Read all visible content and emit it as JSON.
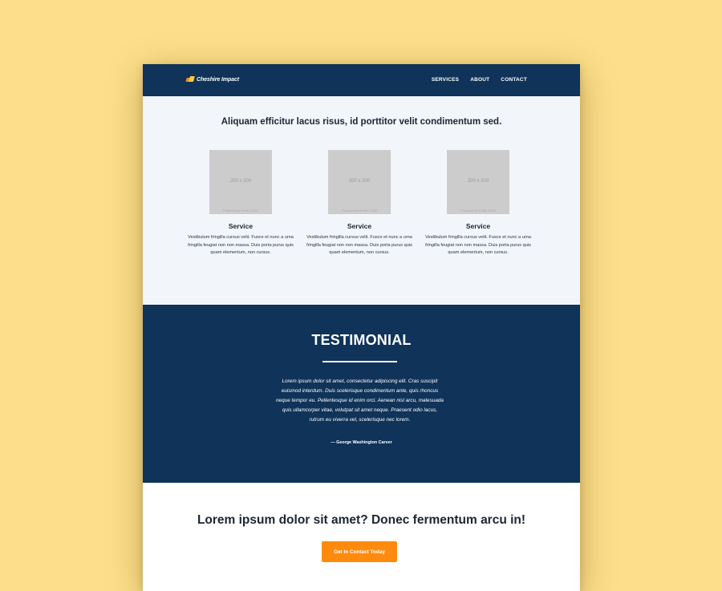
{
  "nav": {
    "logo_text": "Cheshire Impact",
    "links": [
      "SERVICES",
      "ABOUT",
      "CONTACT"
    ]
  },
  "services": {
    "heading": "Aliquam efficitur lacus risus, id porttitor velit condimentum sed.",
    "cards": [
      {
        "image_size": "200 x 200",
        "image_powered": "Powered by HTML.COM",
        "title": "Service",
        "description": "Vestibulum fringilla cursus velit. Fusce et nunc a urna fringilla feugiat non non massa. Duis porta purus quis quam elementum, non cursus."
      },
      {
        "image_size": "200 x 200",
        "image_powered": "Powered by HTML.COM",
        "title": "Service",
        "description": "Vestibulum fringilla cursus velit. Fusce et nunc a urna fringilla feugiat non non massa. Duis porta purus quis quam elementum, non cursus."
      },
      {
        "image_size": "200 x 200",
        "image_powered": "Powered by HTML.COM",
        "title": "Service",
        "description": "Vestibulum fringilla cursus velit. Fusce et nunc a urna fringilla feugiat non non massa. Duis porta purus quis quam elementum, non cursus."
      }
    ]
  },
  "testimonial": {
    "title": "TESTIMONIAL",
    "quote": "Lorem ipsum dolor sit amet, consectetur adipiscing elit. Cras suscipit euismod interdum. Duis scelerisque condimentum ante, quis rhoncus neque tempor eu. Pellentesque id enim orci. Aenean nisl arcu, malesuada quis ullamcorper vitae, volutpat sit amet neque. Praesent odio lacus, rutrum eu viverra vel, scelerisque nec lorem.",
    "author": "— George Washington Carver"
  },
  "cta": {
    "heading": "Lorem ipsum dolor sit amet? Donec fermentum arcu in!",
    "button_label": "Get In Contact Today"
  },
  "colors": {
    "background": "#fddf8b",
    "navy": "#0f3359",
    "light_section": "#f2f5fa",
    "accent_orange": "#ff8a0d",
    "logo_yellow": "#ffc940"
  }
}
